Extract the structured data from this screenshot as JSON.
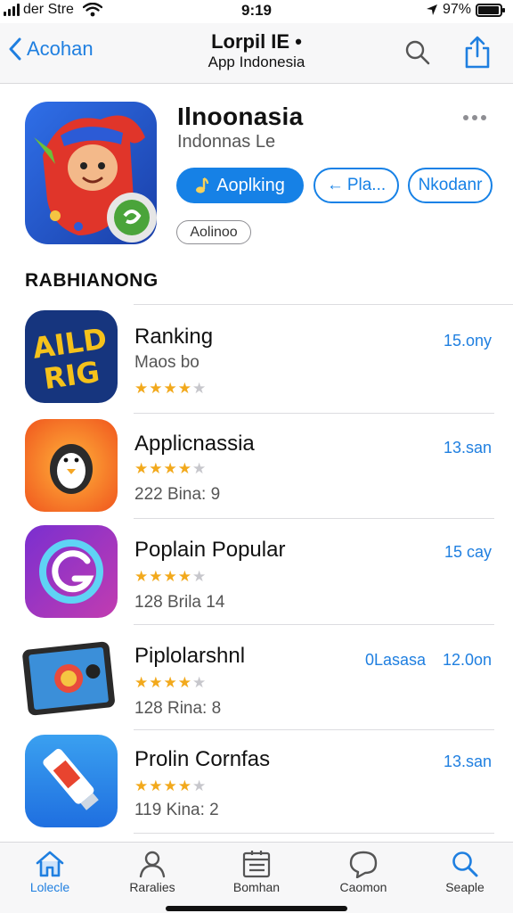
{
  "status_bar": {
    "carrier": "der Stre",
    "time": "9:19",
    "battery": "97%",
    "battery_level": 0.97
  },
  "nav": {
    "back_label": "Acohan",
    "title": "Lorpil IE •",
    "subtitle": "App Indonesia"
  },
  "app": {
    "name": "Ilnoonasia",
    "developer": "Indonnas Le",
    "primary_button": "Aoplking",
    "secondary_button": "Pla...",
    "tertiary_button": "Nkodanr",
    "tag": "Aolinoo"
  },
  "section_title": "RABHIANONG",
  "items": [
    {
      "title": "Ranking",
      "line2": "Maos bo",
      "rating": 4,
      "line3": "",
      "meta": "15.ony",
      "meta2": ""
    },
    {
      "title": "Applicnassia",
      "line2": "",
      "rating": 4,
      "line3": "222 Bina: 9",
      "meta": "13.san",
      "meta2": ""
    },
    {
      "title": "Poplain Popular",
      "line2": "",
      "rating": 4,
      "line3": "128 Brila 14",
      "meta": "15 cay",
      "meta2": ""
    },
    {
      "title": "Piplolarshnl",
      "line2": "",
      "rating": 4,
      "line3": "128 Rina: 8",
      "meta": "12.0on",
      "meta2": "0Lasasa"
    },
    {
      "title": "Prolin Cornfas",
      "line2": "",
      "rating": 4,
      "line3": "119 Kina: 2",
      "meta": "13.san",
      "meta2": ""
    }
  ],
  "tabs": [
    {
      "label": "Lolecle",
      "icon": "home-icon",
      "active": true
    },
    {
      "label": "Raralies",
      "icon": "person-icon",
      "active": false
    },
    {
      "label": "Bomhan",
      "icon": "list-icon",
      "active": false
    },
    {
      "label": "Caomon",
      "icon": "chat-icon",
      "active": false
    },
    {
      "label": "Seaple",
      "icon": "search-icon",
      "active": false
    }
  ],
  "colors": {
    "accent": "#1681e6",
    "star": "#f2a91c"
  }
}
